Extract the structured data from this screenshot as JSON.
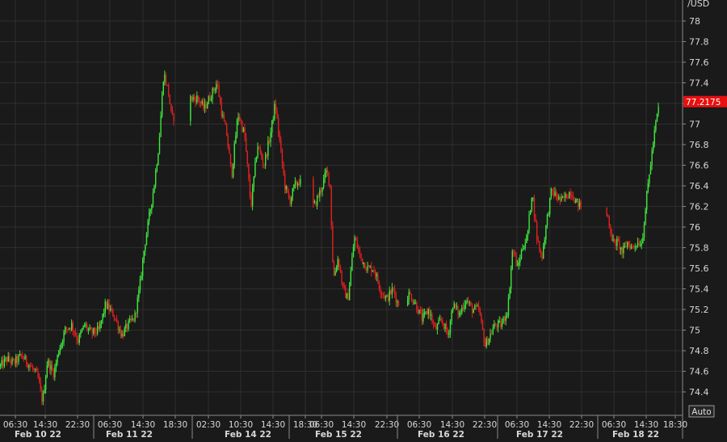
{
  "chart_data": {
    "type": "candlestick",
    "y_unit_label": "/USD",
    "ylim": [
      74.2,
      78.2
    ],
    "y_ticks": [
      78,
      77.8,
      77.6,
      77.4,
      77.2,
      77,
      76.8,
      76.6,
      76.4,
      76.2,
      76,
      75.8,
      75.6,
      75.4,
      75.2,
      75,
      74.8,
      74.6,
      74.4
    ],
    "y_tick_labels": [
      "78",
      "77.8",
      "77.6",
      "77.4",
      "77.2",
      "77",
      "76.8",
      "76.6",
      "76.4",
      "76.2",
      "76",
      "75.8",
      "75.6",
      "75.4",
      "75.2",
      "75",
      "74.8",
      "74.6",
      "74.4"
    ],
    "last_price": 77.2175,
    "last_price_label": "77.2175",
    "x_time_ticks": [
      "06:30",
      "14:30",
      "22:30",
      "06:30",
      "14:30",
      "18:30",
      "02:30",
      "10:30",
      "14:30",
      "18:30",
      "06:30",
      "14:30",
      "22:30",
      "06:30",
      "14:30",
      "22:30",
      "06:30",
      "14:30",
      "22:30",
      "06:30",
      "14:30",
      "18:30"
    ],
    "x_date_labels": [
      "Feb 10 22",
      "Feb 11 22",
      "Feb 14 22",
      "Feb 15 22",
      "Feb 16 22",
      "Feb 17 22",
      "Feb 18 22"
    ],
    "auto_label": "Auto",
    "grid": true,
    "colors": {
      "up": "#3ee63e",
      "down": "#e02020",
      "background": "#1a1a1a",
      "grid": "#2e2e2e",
      "text": "#d8d8d8",
      "price_tag": "#e81010"
    },
    "close_path": [
      [
        0,
        74.65
      ],
      [
        8,
        74.72
      ],
      [
        16,
        74.68
      ],
      [
        26,
        74.75
      ],
      [
        36,
        74.66
      ],
      [
        46,
        74.55
      ],
      [
        52,
        74.3
      ],
      [
        58,
        74.7
      ],
      [
        66,
        74.58
      ],
      [
        72,
        74.8
      ],
      [
        80,
        75.0
      ],
      [
        88,
        75.05
      ],
      [
        96,
        74.9
      ],
      [
        104,
        75.05
      ],
      [
        112,
        74.97
      ],
      [
        122,
        75.0
      ],
      [
        130,
        75.25
      ],
      [
        140,
        75.15
      ],
      [
        150,
        74.95
      ],
      [
        158,
        75.05
      ],
      [
        166,
        75.12
      ],
      [
        172,
        75.4
      ],
      [
        178,
        75.8
      ],
      [
        184,
        76.1
      ],
      [
        190,
        76.4
      ],
      [
        196,
        76.8
      ],
      [
        202,
        77.5
      ],
      [
        208,
        77.3
      ],
      [
        212,
        77.05
      ],
      [
        236,
        77.25
      ],
      [
        244,
        77.25
      ],
      [
        252,
        77.15
      ],
      [
        268,
        77.4
      ],
      [
        274,
        77.1
      ],
      [
        280,
        76.9
      ],
      [
        286,
        76.5
      ],
      [
        294,
        77.1
      ],
      [
        302,
        76.9
      ],
      [
        310,
        76.2
      ],
      [
        318,
        76.8
      ],
      [
        326,
        76.6
      ],
      [
        334,
        76.9
      ],
      [
        340,
        77.2
      ],
      [
        346,
        76.8
      ],
      [
        352,
        76.4
      ],
      [
        358,
        76.25
      ],
      [
        364,
        76.4
      ],
      [
        370,
        76.45
      ],
      [
        388,
        76.2
      ],
      [
        396,
        76.35
      ],
      [
        404,
        76.55
      ],
      [
        408,
        76.4
      ],
      [
        412,
        75.5
      ],
      [
        418,
        75.7
      ],
      [
        424,
        75.4
      ],
      [
        430,
        75.3
      ],
      [
        438,
        75.9
      ],
      [
        446,
        75.7
      ],
      [
        454,
        75.6
      ],
      [
        462,
        75.6
      ],
      [
        470,
        75.4
      ],
      [
        478,
        75.3
      ],
      [
        486,
        75.4
      ],
      [
        492,
        75.25
      ],
      [
        506,
        75.35
      ],
      [
        514,
        75.25
      ],
      [
        522,
        75.1
      ],
      [
        530,
        75.2
      ],
      [
        538,
        75.0
      ],
      [
        546,
        75.1
      ],
      [
        554,
        74.95
      ],
      [
        560,
        75.25
      ],
      [
        568,
        75.15
      ],
      [
        576,
        75.3
      ],
      [
        584,
        75.2
      ],
      [
        592,
        75.2
      ],
      [
        600,
        74.85
      ],
      [
        612,
        75.05
      ],
      [
        620,
        75.05
      ],
      [
        628,
        75.2
      ],
      [
        634,
        75.8
      ],
      [
        640,
        75.6
      ],
      [
        646,
        75.8
      ],
      [
        652,
        75.9
      ],
      [
        658,
        76.35
      ],
      [
        664,
        75.9
      ],
      [
        670,
        75.7
      ],
      [
        676,
        76.05
      ],
      [
        682,
        76.35
      ],
      [
        688,
        76.3
      ],
      [
        694,
        76.25
      ],
      [
        700,
        76.3
      ],
      [
        706,
        76.35
      ],
      [
        712,
        76.25
      ],
      [
        718,
        76.2
      ],
      [
        752,
        76.1
      ],
      [
        758,
        75.85
      ],
      [
        764,
        75.85
      ],
      [
        770,
        75.75
      ],
      [
        776,
        75.85
      ],
      [
        782,
        75.8
      ],
      [
        788,
        75.85
      ],
      [
        794,
        75.85
      ],
      [
        800,
        76.3
      ],
      [
        806,
        76.7
      ],
      [
        812,
        77.05
      ],
      [
        816,
        77.22
      ]
    ]
  }
}
